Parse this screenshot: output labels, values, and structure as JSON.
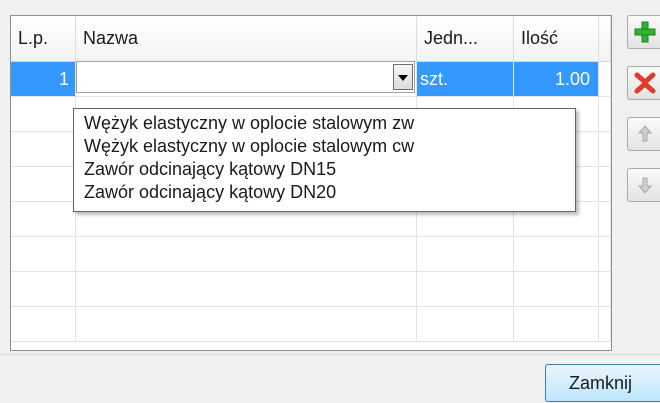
{
  "grid": {
    "headers": {
      "lp": "L.p.",
      "name": "Nazwa",
      "unit": "Jedn...",
      "qty": "Ilość"
    },
    "rows": [
      {
        "lp": "1",
        "name": "",
        "unit": "szt.",
        "qty": "1.00"
      }
    ]
  },
  "dropdown": {
    "options": [
      "Wężyk elastyczny w oplocie stalowym zw",
      "Wężyk elastyczny w oplocie stalowym cw",
      "Zawór odcinający kątowy DN15",
      "Zawór odcinający kątowy DN20"
    ]
  },
  "side_buttons": {
    "icons": [
      "plus-icon",
      "delete-x-icon",
      "arrow-up-icon",
      "arrow-down-icon"
    ]
  },
  "footer": {
    "close_label": "Zamknij"
  },
  "colors": {
    "selection": "#3399ff",
    "add_green": "#2fb52f",
    "delete_red": "#e23a2e"
  }
}
